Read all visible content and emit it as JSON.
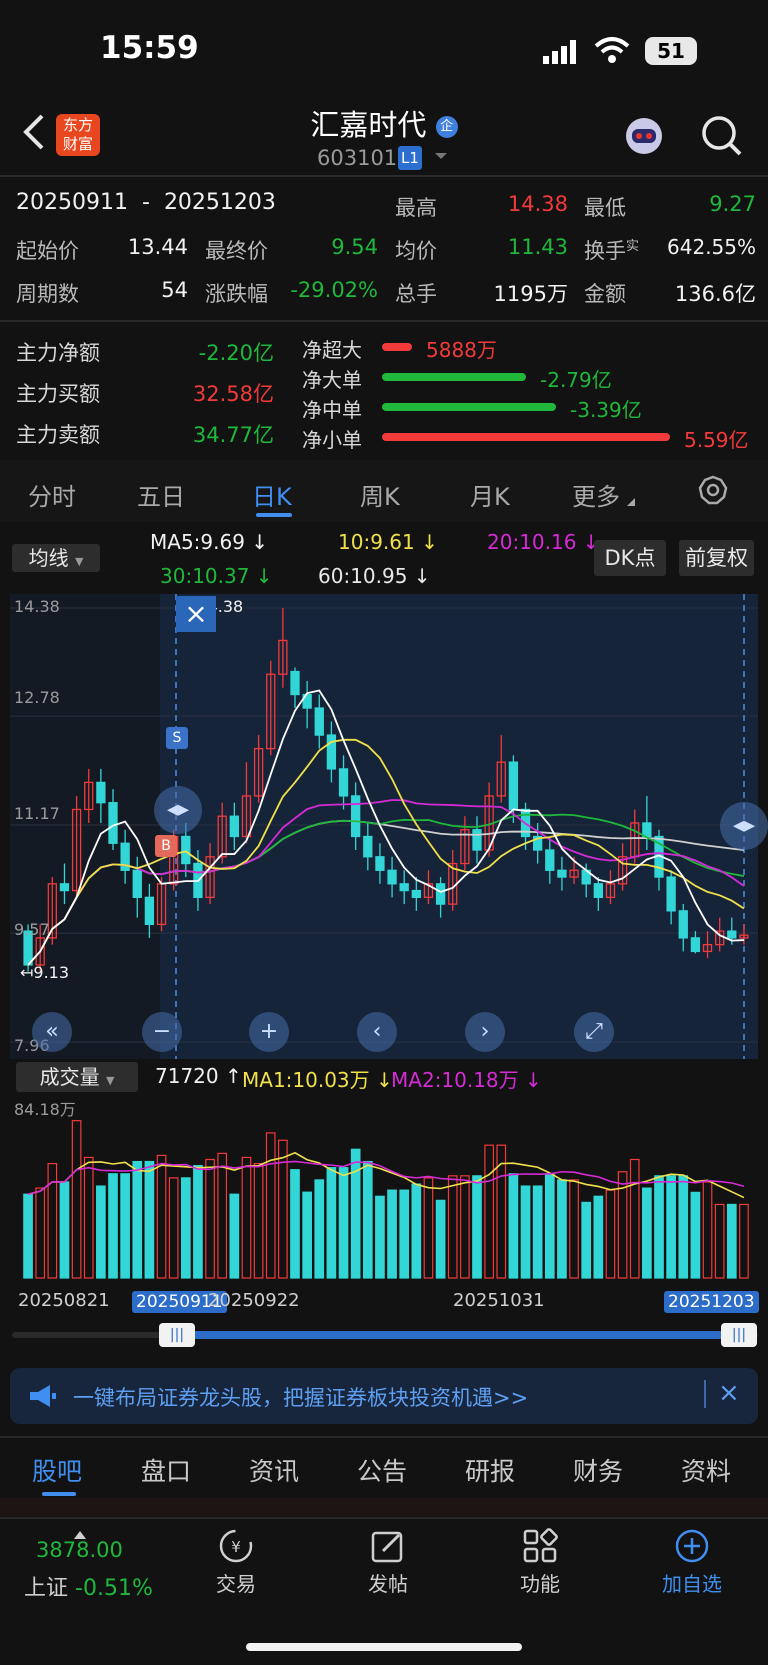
{
  "status": {
    "time": "15:59",
    "battery": "51"
  },
  "header": {
    "title": "汇嘉时代",
    "code": "603101",
    "level": "L1",
    "logo_line1": "东方",
    "logo_line2": "财富",
    "title_badge": "企"
  },
  "stats": {
    "date_range_start": "20250911",
    "date_range_sep": "-",
    "date_range_end": "20251203",
    "high_label": "最高",
    "high": "14.38",
    "low_label": "最低",
    "low": "9.27",
    "open_label": "起始价",
    "open": "13.44",
    "close_label": "最终价",
    "close": "9.54",
    "avg_label": "均价",
    "avg": "11.43",
    "turnover_label": "换手",
    "turnover_sup": "实",
    "turnover": "642.55%",
    "periods_label": "周期数",
    "periods": "54",
    "change_label": "涨跌幅",
    "change": "-29.02%",
    "volume_label": "总手",
    "volume": "1195万",
    "amount_label": "金额",
    "amount": "136.6亿"
  },
  "flows": {
    "net_label": "主力净额",
    "net": "-2.20亿",
    "buy_label": "主力买额",
    "buy": "32.58亿",
    "sell_label": "主力卖额",
    "sell": "34.77亿",
    "super_label": "净超大",
    "super": "5888万",
    "big_label": "净大单",
    "big": "-2.79亿",
    "mid_label": "净中单",
    "mid": "-3.39亿",
    "small_label": "净小单",
    "small": "5.59亿"
  },
  "tabs": [
    "分时",
    "五日",
    "日K",
    "周K",
    "月K",
    "更多"
  ],
  "ma": {
    "selector": "均线",
    "ma5": "MA5:9.69 ↓",
    "ma10": "10:9.61 ↓",
    "ma20": "20:10.16 ↓",
    "ma30": "30:10.37 ↓",
    "ma60": "60:10.95 ↓",
    "dk_button": "DK点",
    "fq_button": "前复权"
  },
  "chart_data": {
    "type": "candlestick",
    "ylim": [
      7.96,
      14.38
    ],
    "y_ticks": [
      "14.38",
      "12.78",
      "11.17",
      "9.57",
      "7.96"
    ],
    "high_marker": "14.38",
    "low_marker": "9.13",
    "range_start": "20250911",
    "range_end": "20251203",
    "colors": {
      "up": "#f23a3a",
      "down": "#33d6d6",
      "ma5": "#ffffff",
      "ma10": "#f0e04a",
      "ma20": "#d62ad6",
      "ma30": "#1fb83a",
      "ma60": "#d0d0d0"
    },
    "x_labels": [
      "20250821",
      "20250922",
      "20251031"
    ],
    "candles": [
      [
        9.6,
        9.1,
        9.7,
        9.0
      ],
      [
        9.1,
        9.5,
        9.7,
        9.0
      ],
      [
        9.5,
        10.3,
        10.4,
        9.4
      ],
      [
        10.3,
        10.2,
        10.6,
        10.0
      ],
      [
        10.2,
        11.4,
        11.6,
        10.1
      ],
      [
        11.4,
        11.8,
        12.0,
        11.2
      ],
      [
        11.8,
        11.5,
        12.0,
        11.2
      ],
      [
        11.5,
        10.9,
        11.7,
        10.8
      ],
      [
        10.9,
        10.5,
        11.1,
        10.3
      ],
      [
        10.5,
        10.1,
        10.7,
        9.8
      ],
      [
        10.1,
        9.7,
        10.3,
        9.5
      ],
      [
        9.7,
        10.3,
        10.4,
        9.6
      ],
      [
        10.3,
        11.0,
        11.1,
        10.2
      ],
      [
        11.0,
        10.6,
        11.2,
        10.4
      ],
      [
        10.6,
        10.1,
        10.8,
        9.9
      ],
      [
        10.1,
        10.7,
        10.9,
        10.0
      ],
      [
        10.7,
        11.3,
        11.5,
        10.6
      ],
      [
        11.3,
        11.0,
        11.5,
        10.8
      ],
      [
        11.0,
        11.6,
        12.1,
        10.9
      ],
      [
        11.6,
        12.3,
        12.5,
        11.5
      ],
      [
        12.3,
        13.4,
        13.6,
        12.2
      ],
      [
        13.4,
        13.9,
        14.38,
        13.2
      ],
      [
        13.44,
        13.1,
        13.5,
        12.9
      ],
      [
        13.1,
        12.9,
        13.3,
        12.6
      ],
      [
        12.9,
        12.5,
        13.1,
        12.3
      ],
      [
        12.5,
        12.0,
        12.7,
        11.8
      ],
      [
        12.0,
        11.6,
        12.2,
        11.4
      ],
      [
        11.6,
        11.0,
        11.8,
        10.8
      ],
      [
        11.0,
        10.7,
        11.2,
        10.5
      ],
      [
        10.7,
        10.5,
        10.9,
        10.3
      ],
      [
        10.5,
        10.3,
        10.7,
        10.1
      ],
      [
        10.3,
        10.2,
        10.5,
        10.0
      ],
      [
        10.2,
        10.1,
        10.4,
        9.9
      ],
      [
        10.1,
        10.3,
        10.5,
        10.0
      ],
      [
        10.3,
        10.0,
        10.4,
        9.8
      ],
      [
        10.0,
        10.6,
        10.8,
        9.9
      ],
      [
        10.6,
        11.1,
        11.3,
        10.5
      ],
      [
        11.1,
        10.8,
        11.3,
        10.6
      ],
      [
        10.8,
        11.6,
        11.8,
        10.7
      ],
      [
        11.6,
        12.1,
        12.5,
        11.5
      ],
      [
        12.1,
        11.4,
        12.2,
        11.2
      ],
      [
        11.4,
        11.0,
        11.5,
        10.8
      ],
      [
        11.0,
        10.8,
        11.2,
        10.6
      ],
      [
        10.8,
        10.5,
        11.0,
        10.3
      ],
      [
        10.5,
        10.4,
        10.7,
        10.2
      ],
      [
        10.4,
        10.5,
        10.7,
        10.3
      ],
      [
        10.5,
        10.3,
        10.6,
        10.1
      ],
      [
        10.3,
        10.1,
        10.4,
        9.9
      ],
      [
        10.1,
        10.3,
        10.5,
        10.0
      ],
      [
        10.3,
        10.7,
        10.9,
        10.2
      ],
      [
        10.7,
        11.2,
        11.4,
        10.6
      ],
      [
        11.2,
        11.0,
        11.6,
        10.8
      ],
      [
        11.0,
        10.4,
        11.1,
        10.2
      ],
      [
        10.4,
        9.9,
        10.5,
        9.7
      ],
      [
        9.9,
        9.5,
        10.0,
        9.3
      ],
      [
        9.5,
        9.3,
        9.6,
        9.27
      ],
      [
        9.3,
        9.4,
        9.6,
        9.2
      ],
      [
        9.4,
        9.6,
        9.8,
        9.3
      ],
      [
        9.6,
        9.5,
        9.8,
        9.4
      ],
      [
        9.5,
        9.54,
        9.7,
        9.4
      ]
    ],
    "volume": {
      "label": "成交量",
      "current": "71720 ↑",
      "ma1": "MA1:10.03万 ↓",
      "ma2": "MA2:10.18万 ↓",
      "max_label": "84.18万",
      "ylim": [
        0,
        84.18
      ]
    }
  },
  "slider": {
    "start_label": "20250911",
    "end_label": "20251203"
  },
  "banner": {
    "text": "一键布局证券龙头股，把握证券板块投资机遇>>"
  },
  "bottom_tabs": [
    "股吧",
    "盘口",
    "资讯",
    "公告",
    "研报",
    "财务",
    "资料"
  ],
  "bottom_bar": {
    "index_value": "3878.00",
    "index_name": "上证",
    "index_change": "-0.51%",
    "trade": "交易",
    "post": "发帖",
    "func": "功能",
    "add": "加自选"
  },
  "chart_controls": {
    "close": "×",
    "zoom_out": "−",
    "zoom_in": "+",
    "prev": "‹",
    "next": "›"
  },
  "markers": {
    "s": "S",
    "b": "B"
  }
}
